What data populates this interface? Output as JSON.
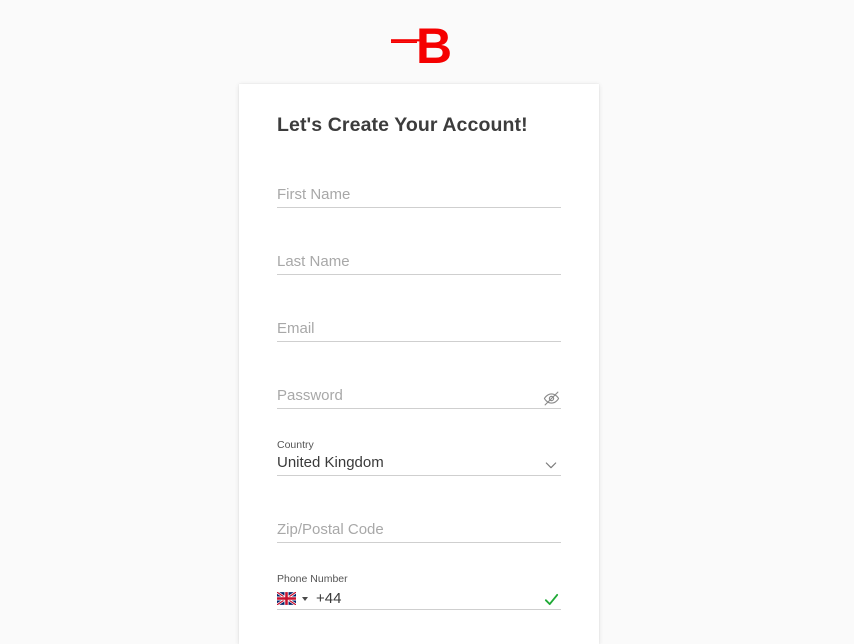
{
  "brand": {
    "logo_icon": "letter-b-logo",
    "logo_letter": "B",
    "color": "#f50000"
  },
  "form": {
    "title": "Let's Create Your Account!",
    "fields": [
      {
        "name": "first-name",
        "placeholder": "First Name",
        "value": ""
      },
      {
        "name": "last-name",
        "placeholder": "Last Name",
        "value": ""
      },
      {
        "name": "email",
        "placeholder": "Email",
        "value": ""
      },
      {
        "name": "password",
        "placeholder": "Password",
        "value": "",
        "trailing_icon": "eye-off-icon"
      },
      {
        "name": "country",
        "label": "Country",
        "value": "United Kingdom",
        "trailing_icon": "chevron-down-icon"
      },
      {
        "name": "zip-postal-code",
        "placeholder": "Zip/Postal Code",
        "value": ""
      },
      {
        "name": "phone-number",
        "label": "Phone Number",
        "value": "+44",
        "flag": "united-kingdom-flag",
        "trailing_icon": "check-icon",
        "valid": true
      }
    ]
  },
  "colors": {
    "page_background": "#fafafa",
    "card_background": "#ffffff",
    "title_text": "#3c3c3c",
    "placeholder_text": "#a8a8a8",
    "value_text": "#3a3a3a",
    "label_text": "#555555",
    "underline": "#cfcfcf",
    "success": "#1faa36",
    "brand_red": "#f50000"
  }
}
